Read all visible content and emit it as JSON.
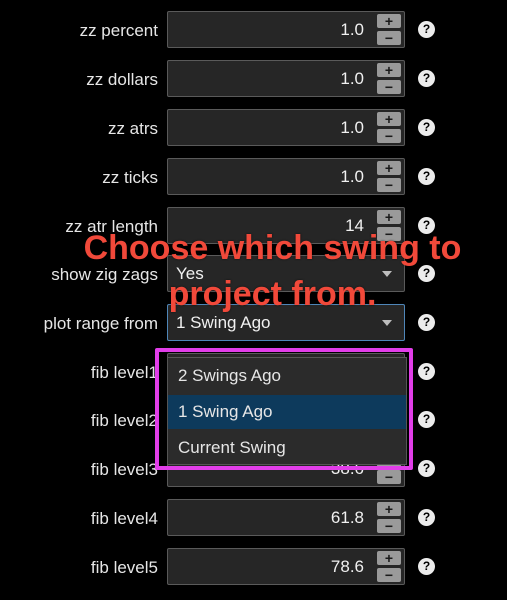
{
  "settings": {
    "rows": [
      {
        "label": "zz percent",
        "value": "1.0"
      },
      {
        "label": "zz dollars",
        "value": "1.0"
      },
      {
        "label": "zz atrs",
        "value": "1.0"
      },
      {
        "label": "zz ticks",
        "value": "1.0"
      },
      {
        "label": "zz atr length",
        "value": "14"
      },
      {
        "label": "show zig zags",
        "value": "Yes"
      },
      {
        "label": "plot range from",
        "value": "1 Swing Ago"
      },
      {
        "label": "fib level1",
        "value": ""
      },
      {
        "label": "fib level2",
        "value": ""
      },
      {
        "label": "fib level3",
        "value": "38.6"
      },
      {
        "label": "fib level4",
        "value": "61.8"
      },
      {
        "label": "fib level5",
        "value": "78.6"
      }
    ],
    "stepper_plus": "+",
    "stepper_minus": "−",
    "help_glyph": "?"
  },
  "dropdown": {
    "options": [
      "2 Swings Ago",
      "1 Swing Ago",
      "Current Swing"
    ],
    "selected": "1 Swing Ago"
  },
  "annotation": {
    "line1": "Choose which swing to",
    "line2": "project from.",
    "text_color": "#f1493a",
    "highlight_color": "#e23ee9"
  }
}
